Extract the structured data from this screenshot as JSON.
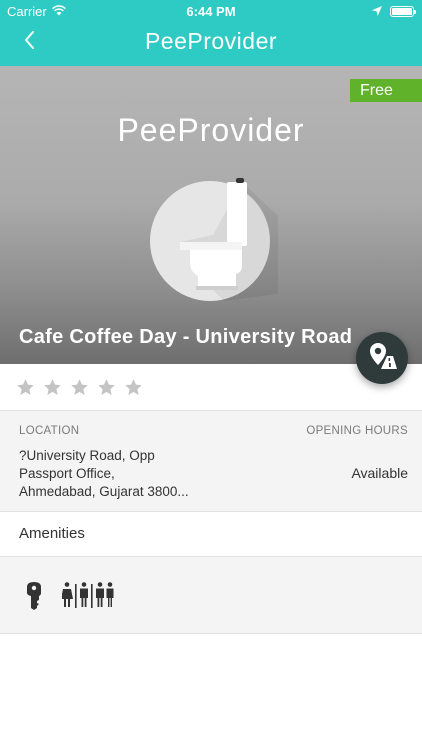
{
  "status_bar": {
    "carrier": "Carrier",
    "time": "6:44 PM",
    "battery_level": 1.0
  },
  "nav": {
    "title": "PeeProvider",
    "back_icon": "chevron-left-icon"
  },
  "hero": {
    "badge": "Free",
    "brand": "PeeProvider",
    "place_name": "Cafe Coffee Day - University Road",
    "image_icon": "toilet-icon"
  },
  "directions_button": {
    "icon": "map-directions-icon"
  },
  "rating": {
    "value": 0,
    "max": 5
  },
  "info": {
    "location_label": "LOCATION",
    "address_lines": [
      "?University Road, Opp",
      "Passport Office,",
      "Ahmedabad, Gujarat 3800..."
    ],
    "hours_label": "OPENING HOURS",
    "hours_value": "Available"
  },
  "amenities": {
    "title": "Amenities",
    "icons": [
      "key-icon",
      "gender-restroom-icon"
    ]
  },
  "colors": {
    "nav": "#2ecbc4",
    "badge": "#5fb22a",
    "fab": "#2f3b3b",
    "star_empty": "#c4c4c4"
  }
}
